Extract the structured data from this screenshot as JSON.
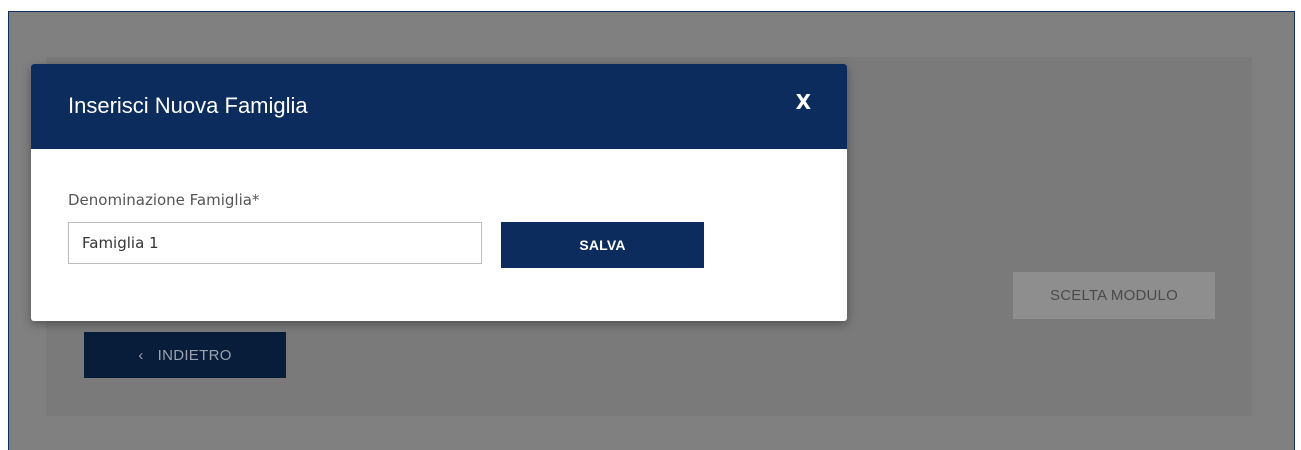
{
  "background": {
    "back_button_label": "INDIETRO",
    "back_icon": "chevron-left-icon",
    "back_icon_glyph": "‹",
    "module_button_label": "SCELTA MODULO"
  },
  "modal": {
    "title": "Inserisci Nuova Famiglia",
    "close_label": "X",
    "field_label": "Denominazione Famiglia*",
    "field_value": "Famiglia 1",
    "save_label": "SALVA"
  },
  "colors": {
    "header_navy": "#0b2c5c",
    "dark_button": "#071d3a",
    "overlay_gray": "#808080",
    "disabled_button": "#8e8e8e"
  }
}
